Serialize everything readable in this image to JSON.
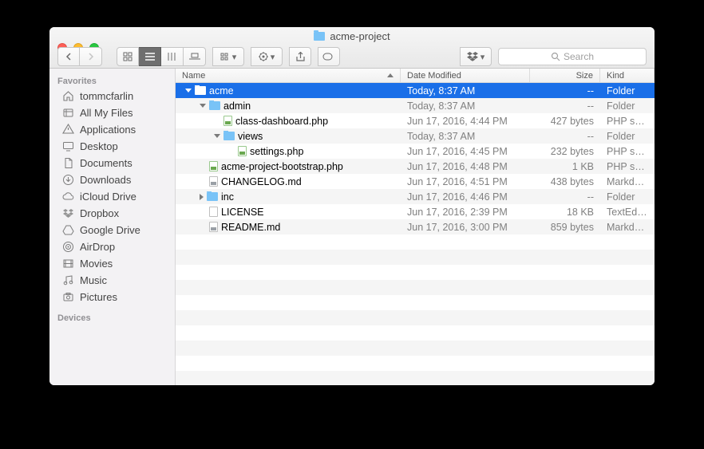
{
  "window": {
    "title": "acme-project"
  },
  "search": {
    "placeholder": "Search"
  },
  "sidebar": {
    "section_favorites": "Favorites",
    "section_devices": "Devices",
    "items": [
      {
        "label": "tommcfarlin",
        "icon": "home"
      },
      {
        "label": "All My Files",
        "icon": "allfiles"
      },
      {
        "label": "Applications",
        "icon": "apps"
      },
      {
        "label": "Desktop",
        "icon": "desktop"
      },
      {
        "label": "Documents",
        "icon": "docs"
      },
      {
        "label": "Downloads",
        "icon": "downloads"
      },
      {
        "label": "iCloud Drive",
        "icon": "cloud"
      },
      {
        "label": "Dropbox",
        "icon": "dropbox"
      },
      {
        "label": "Google Drive",
        "icon": "gdrive"
      },
      {
        "label": "AirDrop",
        "icon": "airdrop"
      },
      {
        "label": "Movies",
        "icon": "movies"
      },
      {
        "label": "Music",
        "icon": "music"
      },
      {
        "label": "Pictures",
        "icon": "pictures"
      }
    ]
  },
  "columns": {
    "name": "Name",
    "date": "Date Modified",
    "size": "Size",
    "kind": "Kind"
  },
  "files": [
    {
      "indent": 0,
      "disclosure": "down",
      "icon": "folder",
      "name": "acme",
      "date": "Today, 8:37 AM",
      "size": "--",
      "kind": "Folder",
      "selected": true
    },
    {
      "indent": 1,
      "disclosure": "down",
      "icon": "folder",
      "name": "admin",
      "date": "Today, 8:37 AM",
      "size": "--",
      "kind": "Folder"
    },
    {
      "indent": 2,
      "disclosure": "",
      "icon": "php",
      "name": "class-dashboard.php",
      "date": "Jun 17, 2016, 4:44 PM",
      "size": "427 bytes",
      "kind": "PHP sou…"
    },
    {
      "indent": 2,
      "disclosure": "down",
      "icon": "folder",
      "name": "views",
      "date": "Today, 8:37 AM",
      "size": "--",
      "kind": "Folder"
    },
    {
      "indent": 3,
      "disclosure": "",
      "icon": "php",
      "name": "settings.php",
      "date": "Jun 17, 2016, 4:45 PM",
      "size": "232 bytes",
      "kind": "PHP sou…"
    },
    {
      "indent": 1,
      "disclosure": "",
      "icon": "php",
      "name": "acme-project-bootstrap.php",
      "date": "Jun 17, 2016, 4:48 PM",
      "size": "1 KB",
      "kind": "PHP sou…"
    },
    {
      "indent": 1,
      "disclosure": "",
      "icon": "md",
      "name": "CHANGELOG.md",
      "date": "Jun 17, 2016, 4:51 PM",
      "size": "438 bytes",
      "kind": "Markd…"
    },
    {
      "indent": 1,
      "disclosure": "right",
      "icon": "folder",
      "name": "inc",
      "date": "Jun 17, 2016, 4:46 PM",
      "size": "--",
      "kind": "Folder"
    },
    {
      "indent": 1,
      "disclosure": "",
      "icon": "file",
      "name": "LICENSE",
      "date": "Jun 17, 2016, 2:39 PM",
      "size": "18 KB",
      "kind": "TextEd…"
    },
    {
      "indent": 1,
      "disclosure": "",
      "icon": "md",
      "name": "README.md",
      "date": "Jun 17, 2016, 3:00 PM",
      "size": "859 bytes",
      "kind": "Markd…"
    }
  ]
}
